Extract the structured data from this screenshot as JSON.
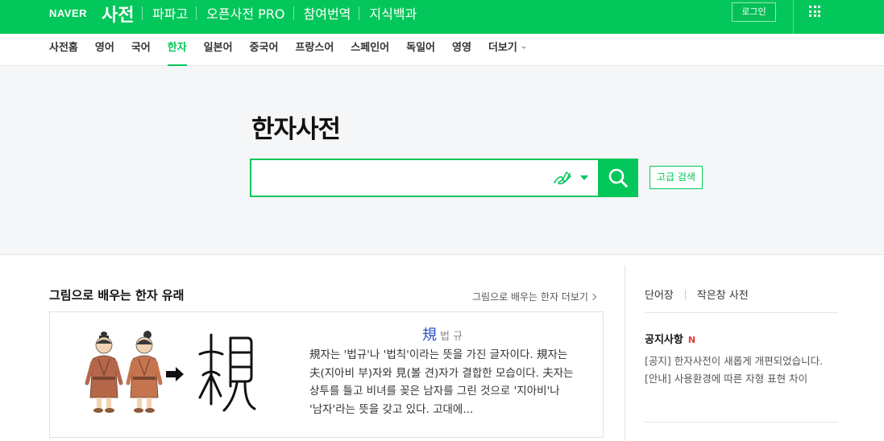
{
  "header": {
    "brand": "NAVER",
    "service": "사전",
    "nav": [
      "파파고",
      "오픈사전 PRO",
      "참여번역",
      "지식백과"
    ],
    "login_label": "로그인",
    "apps_icon": "grid-icon"
  },
  "langnav": {
    "tabs": [
      "사전홈",
      "영어",
      "국어",
      "한자",
      "일본어",
      "중국어",
      "프랑스어",
      "스페인어",
      "독일어",
      "영영",
      "더보기"
    ],
    "active_index": 3
  },
  "hero": {
    "title": "한자사전",
    "search_value": "",
    "search_placeholder": "",
    "handwriting_icon": "handwriting-icon",
    "search_icon": "search-icon",
    "advanced_label": "고급 검색"
  },
  "learn": {
    "title": "그림으로 배우는 한자 유래",
    "more_label": "그림으로 배우는 한자 더보기",
    "hanja": "規",
    "reading": "법 규",
    "description": "規자는 '법규'나 '법칙'이라는 뜻을 가진 글자이다. 規자는 夫(지아비 부)자와 見(볼 견)자가 결합한 모습이다. 夫자는 상투를 틀고 비녀를 꽂은 남자를 그린 것으로 '지아비'나 '남자'라는 뜻을 갖고 있다. 고대에..."
  },
  "side": {
    "links": [
      "단어장",
      "작은창 사전"
    ],
    "notice_title": "공지사항",
    "notice_badge": "N",
    "notices": [
      "[공지] 한자사전이 새롭게 개편되었습니다.",
      "[안내] 사용환경에 따른 자형 표현 차이"
    ]
  },
  "colors": {
    "brand_green": "#03c75a",
    "hanja_blue": "#2b53c4",
    "new_red": "#e53935"
  }
}
